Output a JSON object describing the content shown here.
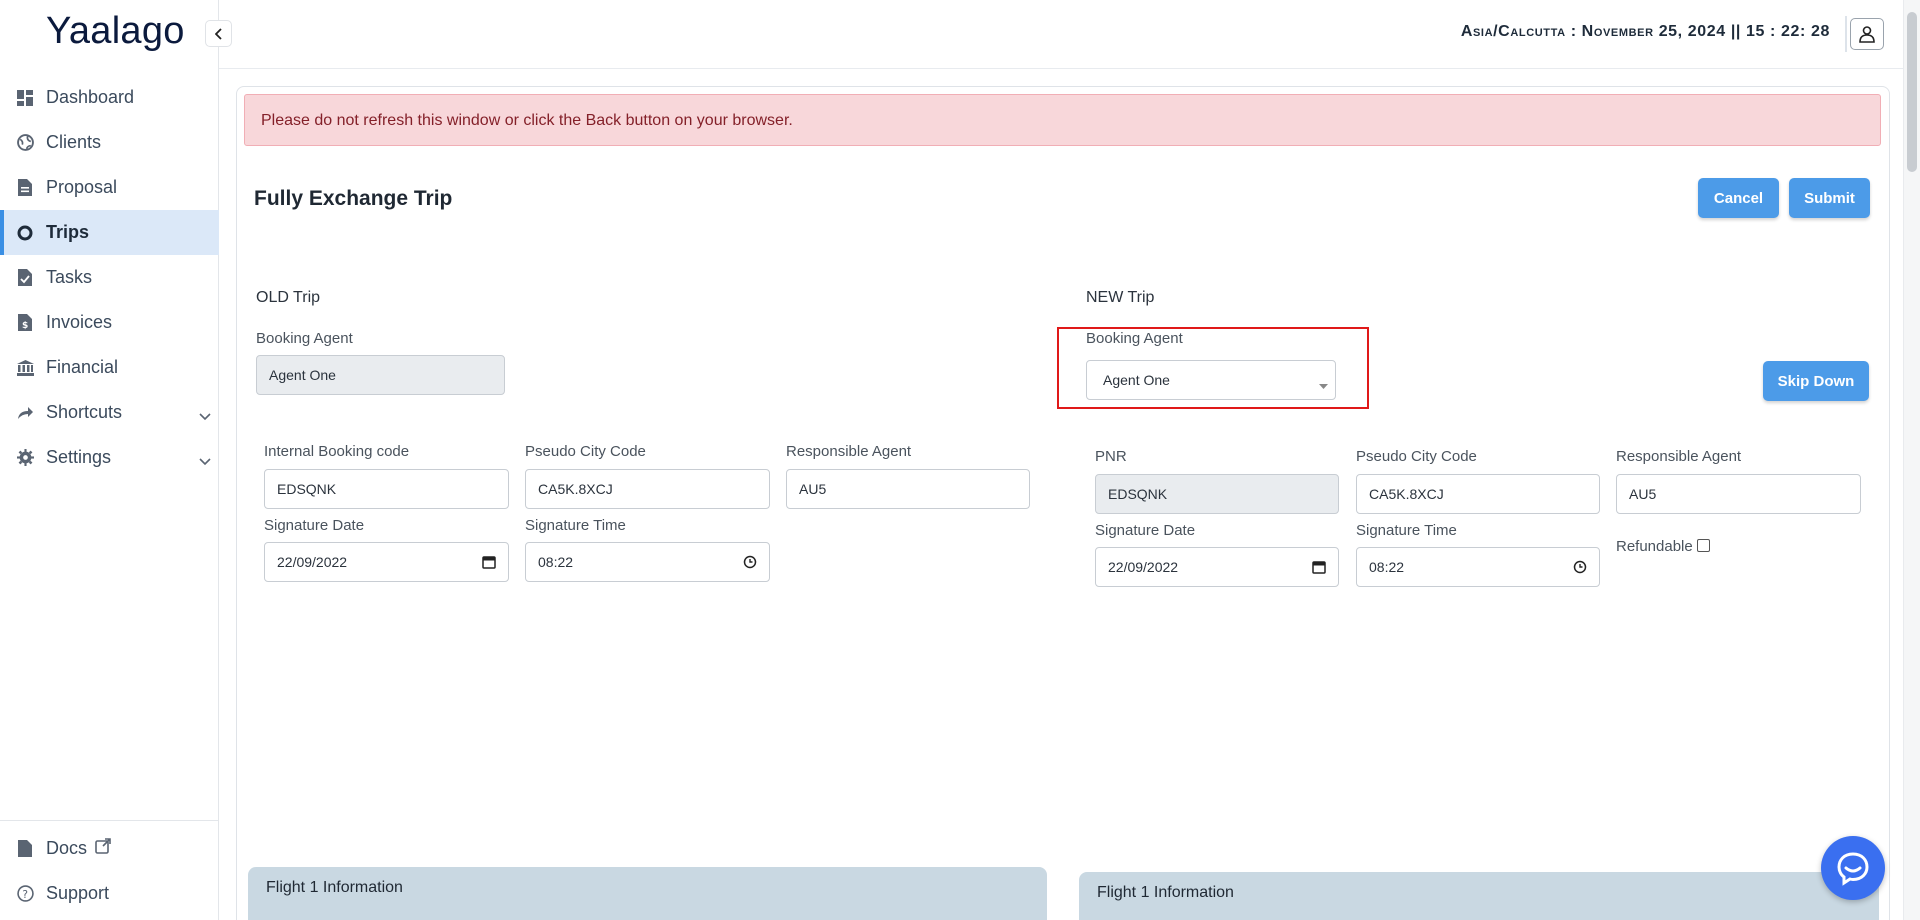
{
  "app": {
    "logo": "Yaalago",
    "datetime": "Asia/Calcutta : November 25, 2024 || 15 : 22: 28"
  },
  "sidebar": {
    "items": [
      {
        "label": "Dashboard",
        "icon": "dashboard-icon"
      },
      {
        "label": "Clients",
        "icon": "globe-icon"
      },
      {
        "label": "Proposal",
        "icon": "document-icon"
      },
      {
        "label": "Trips",
        "icon": "circle-icon",
        "active": true
      },
      {
        "label": "Tasks",
        "icon": "task-file-icon"
      },
      {
        "label": "Invoices",
        "icon": "invoice-icon"
      },
      {
        "label": "Financial",
        "icon": "bank-icon"
      },
      {
        "label": "Shortcuts",
        "icon": "share-arrow-icon",
        "expandable": true
      },
      {
        "label": "Settings",
        "icon": "gear-icon",
        "expandable": true
      }
    ],
    "bottom": [
      {
        "label": "Docs",
        "icon": "document-icon",
        "external": true
      },
      {
        "label": "Support",
        "icon": "help-icon"
      }
    ]
  },
  "main": {
    "alert": "Please do not refresh this window or click the Back button on your browser.",
    "title": "Fully Exchange Trip",
    "cancel_label": "Cancel",
    "submit_label": "Submit",
    "skip_down_label": "Skip Down",
    "old_trip": {
      "heading": "OLD Trip",
      "booking_agent_label": "Booking Agent",
      "booking_agent_value": "Agent One",
      "internal_code_label": "Internal Booking code",
      "internal_code_value": "EDSQNK",
      "pcc_label": "Pseudo City Code",
      "pcc_value": "CA5K.8XCJ",
      "resp_agent_label": "Responsible Agent",
      "resp_agent_value": "AU5",
      "sig_date_label": "Signature Date",
      "sig_date_value": "22/09/2022",
      "sig_time_label": "Signature Time",
      "sig_time_value": "08:22",
      "flight_heading": "Flight 1 Information"
    },
    "new_trip": {
      "heading": "NEW Trip",
      "booking_agent_label": "Booking Agent",
      "booking_agent_value": "Agent One",
      "pnr_label": "PNR",
      "pnr_value": "EDSQNK",
      "pcc_label": "Pseudo City Code",
      "pcc_value": "CA5K.8XCJ",
      "resp_agent_label": "Responsible Agent",
      "resp_agent_value": "AU5",
      "sig_date_label": "Signature Date",
      "sig_date_value": "22/09/2022",
      "sig_time_label": "Signature Time",
      "sig_time_value": "08:22",
      "refundable_label": "Refundable",
      "flight_heading": "Flight 1 Information"
    }
  },
  "colors": {
    "accent": "#4c9be8",
    "alert_bg": "#f8d7da",
    "alert_text": "#842029",
    "highlight": "#e01919",
    "chat": "#3a6ff0"
  }
}
